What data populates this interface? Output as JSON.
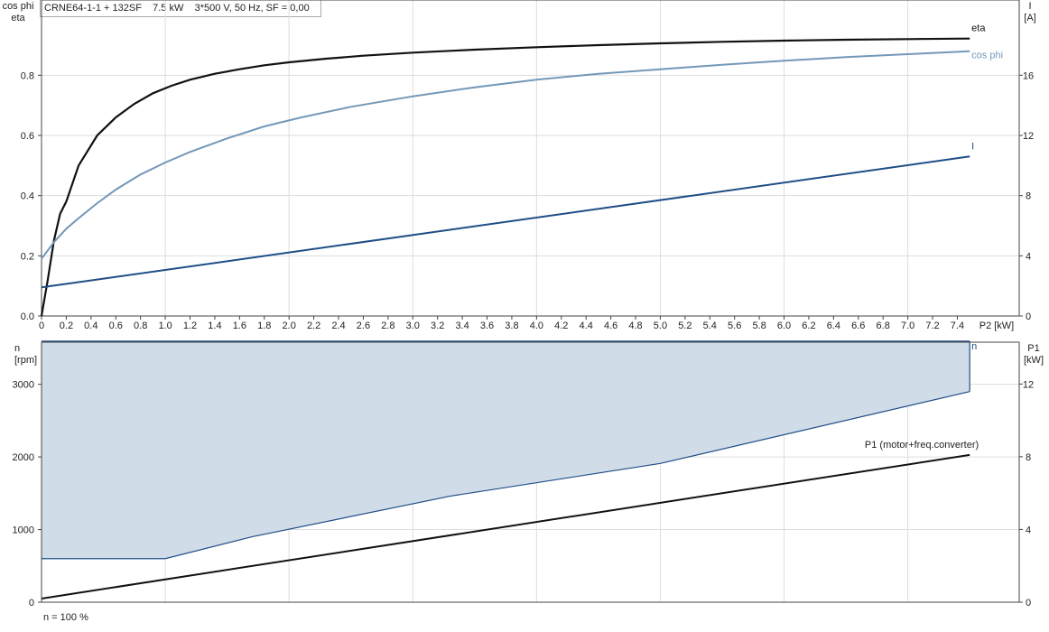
{
  "title": "CRNE64-1-1 + 132SF    7.5 kW    3*500 V, 50 Hz, SF = 0,00",
  "footer": "n = 100 %",
  "colors": {
    "eta": "#111111",
    "cosphi": "#7398b8",
    "current": "#1f4e86",
    "speed": "#1f4e86",
    "speed_fill": "#d0dce8",
    "p1": "#111111",
    "grid": "#dddddd",
    "axis": "#444444"
  },
  "chart_data": [
    {
      "type": "line",
      "xlabel": "P2 [kW]",
      "xlim": [
        0,
        7.9
      ],
      "x_ticks": [
        "0",
        "0.2",
        "0.4",
        "0.6",
        "0.8",
        "1.0",
        "1.2",
        "1.4",
        "1.6",
        "1.8",
        "2.0",
        "2.2",
        "2.4",
        "2.6",
        "2.8",
        "3.0",
        "3.2",
        "3.4",
        "3.6",
        "3.8",
        "4.0",
        "4.2",
        "4.4",
        "4.6",
        "4.8",
        "5.0",
        "5.2",
        "5.4",
        "5.6",
        "5.8",
        "6.0",
        "6.2",
        "6.4",
        "6.6",
        "6.8",
        "7.0",
        "7.2",
        "7.4"
      ],
      "left_axis": {
        "label": [
          "cos phi",
          "eta"
        ],
        "lim": [
          0,
          1.05
        ],
        "ticks": [
          "0.0",
          "0.2",
          "0.4",
          "0.6",
          "0.8"
        ]
      },
      "right_axis": {
        "label": [
          "I",
          "[A]"
        ],
        "lim": [
          0,
          21
        ],
        "ticks": [
          "0",
          "4",
          "8",
          "12",
          "16"
        ]
      },
      "series": [
        {
          "name": "eta",
          "axis": "left",
          "color_key": "eta",
          "x": [
            0,
            0.05,
            0.1,
            0.15,
            0.2,
            0.3,
            0.45,
            0.6,
            0.75,
            0.9,
            1.05,
            1.2,
            1.4,
            1.6,
            1.8,
            2.0,
            2.3,
            2.6,
            3.0,
            3.5,
            4.0,
            4.5,
            5.0,
            5.5,
            6.0,
            6.5,
            7.0,
            7.5
          ],
          "y": [
            0,
            0.12,
            0.25,
            0.34,
            0.38,
            0.5,
            0.6,
            0.66,
            0.705,
            0.74,
            0.765,
            0.785,
            0.805,
            0.82,
            0.833,
            0.843,
            0.855,
            0.865,
            0.875,
            0.885,
            0.893,
            0.9,
            0.906,
            0.911,
            0.915,
            0.918,
            0.92,
            0.922
          ]
        },
        {
          "name": "cos phi",
          "axis": "left",
          "color_key": "cosphi",
          "x": [
            0,
            0.1,
            0.2,
            0.3,
            0.45,
            0.6,
            0.8,
            1.0,
            1.2,
            1.5,
            1.8,
            2.1,
            2.5,
            3.0,
            3.5,
            4.0,
            4.5,
            5.0,
            5.5,
            6.0,
            6.5,
            7.0,
            7.5
          ],
          "y": [
            0.19,
            0.245,
            0.29,
            0.325,
            0.375,
            0.42,
            0.47,
            0.51,
            0.545,
            0.59,
            0.63,
            0.66,
            0.695,
            0.73,
            0.76,
            0.785,
            0.805,
            0.82,
            0.835,
            0.848,
            0.86,
            0.87,
            0.88
          ]
        },
        {
          "name": "I",
          "axis": "right",
          "color_key": "current",
          "x": [
            0,
            7.5
          ],
          "y": [
            1.9,
            10.6
          ]
        }
      ]
    },
    {
      "type": "area",
      "xlim": [
        0,
        7.9
      ],
      "left_axis": {
        "label": [
          "n",
          "[rpm]"
        ],
        "lim": [
          0,
          3580
        ],
        "ticks": [
          "0",
          "1000",
          "2000",
          "3000"
        ]
      },
      "right_axis": {
        "label": [
          "P1",
          "[kW]"
        ],
        "lim": [
          0,
          14.3
        ],
        "ticks": [
          "0",
          "4",
          "8",
          "12"
        ]
      },
      "series": [
        {
          "name": "n",
          "axis": "left",
          "color_key": "speed",
          "x": [
            0,
            7.5
          ],
          "y": [
            3590,
            3590
          ]
        },
        {
          "name": "",
          "axis": "left",
          "color_key": "speed",
          "x": [
            0,
            1.0,
            1.7,
            3.3,
            5.0,
            7.5
          ],
          "y": [
            600,
            600,
            900,
            1460,
            1910,
            2900
          ]
        },
        {
          "name": "P1 (motor+freq.converter)",
          "axis": "right",
          "color_key": "p1",
          "x": [
            0,
            7.5
          ],
          "y": [
            0.2,
            8.1
          ]
        }
      ]
    }
  ]
}
